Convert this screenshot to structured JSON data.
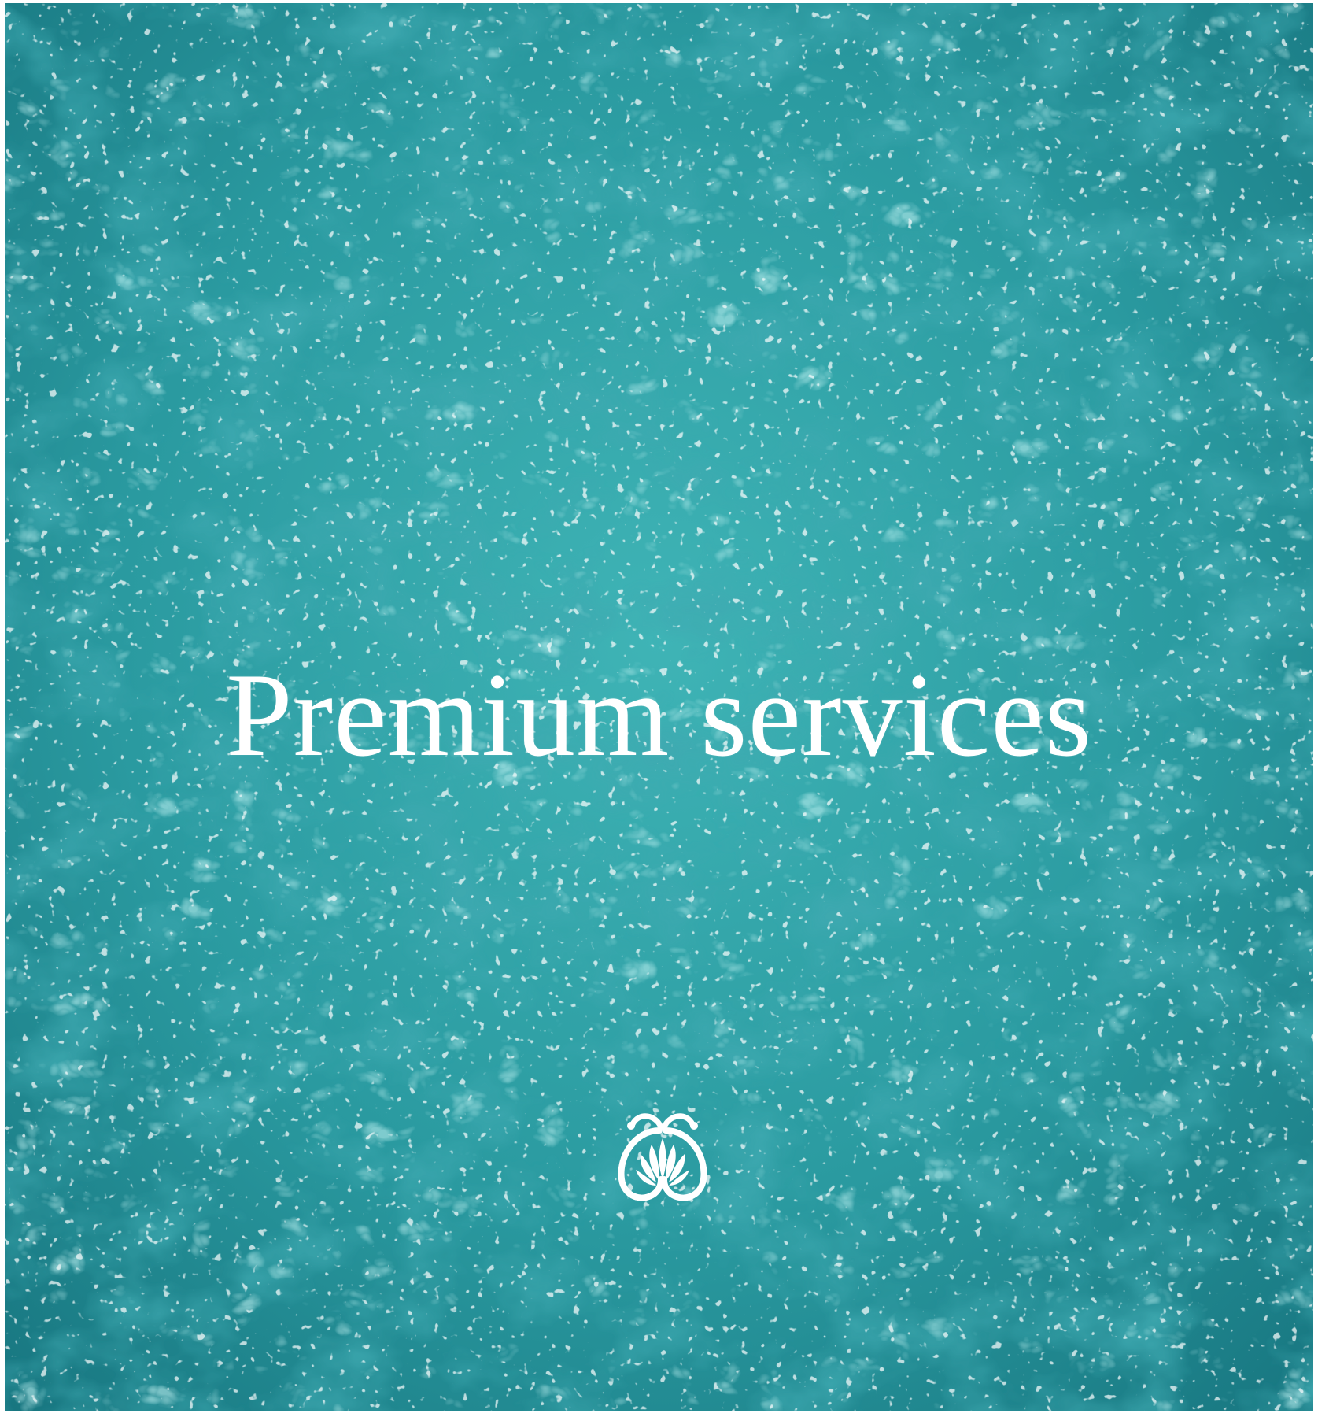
{
  "hero": {
    "title": "Premium services"
  },
  "logo": {
    "icon": "lotus-emblem-icon",
    "color": "#ffffff"
  },
  "colors": {
    "water_base": "#2a9aa0",
    "water_light": "#6fd3d3",
    "water_dark": "#0e6670",
    "text": "#ffffff",
    "page_background": "#ffffff"
  }
}
